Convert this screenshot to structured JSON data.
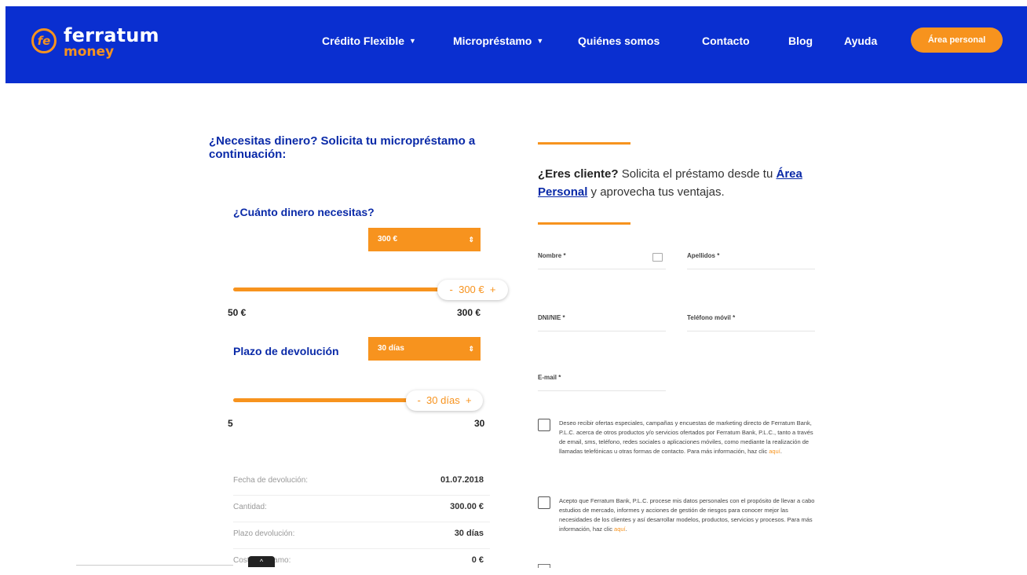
{
  "brand": {
    "name": "ferratum",
    "sub": "money",
    "mark": "fe",
    "accent": "#f7931e",
    "nav_bg": "#0a2fd0"
  },
  "nav": {
    "items": [
      {
        "label": "Crédito Flexible",
        "caret": "▼"
      },
      {
        "label": "Micropréstamo",
        "caret": "▼"
      },
      {
        "label": "Quiénes somos"
      },
      {
        "label": "Contacto"
      },
      {
        "label": "Blog"
      },
      {
        "label": "Ayuda"
      }
    ],
    "cta": "Área personal"
  },
  "loan_form": {
    "title": "¿Necesitas dinero? Solicita tu micropréstamo a continuación:",
    "amount": {
      "question": "¿Cuánto dinero necesitas?",
      "select_value": "300 €",
      "slider_value": "300 €",
      "slider_fraction": 1.0,
      "min": "50 €",
      "max": "300 €",
      "minus": "-",
      "plus": "+"
    },
    "term": {
      "question": "Plazo de devolución",
      "select_value": "30 días",
      "slider_value": "30 días",
      "slider_fraction": 1.0,
      "min": "5",
      "max": "30",
      "minus": "-",
      "plus": "+"
    },
    "summary": [
      {
        "key": "Fecha de devolución:",
        "value": "01.07.2018"
      },
      {
        "key": "Cantidad:",
        "value": "300.00 €"
      },
      {
        "key": "Plazo devolución:",
        "value": "30 días"
      },
      {
        "key": "Coste préstamo:",
        "value": "0 €"
      }
    ]
  },
  "client": {
    "bold": "¿Eres cliente?",
    "text1": " Solicita el préstamo desde tu ",
    "link": "Área Personal",
    "text2": " y aprovecha tus ventajas."
  },
  "fields": {
    "nombre": "Nombre *",
    "apellidos": "Apellidos *",
    "dni": "DNI/NIE *",
    "telefono": "Teléfono móvil *",
    "email": "E-mail *"
  },
  "consents": [
    {
      "text": "Deseo recibir ofertas especiales, campañas y encuestas de marketing directo de Ferratum Bank, P.L.C. acerca de otros productos y/o servicios ofertados por Ferratum Bank, P.L.C., tanto a través de email, sms, teléfono, redes sociales o aplicaciones móviles, como mediante la realización de llamadas telefónicas u otras formas de contacto. Para más información, haz clic ",
      "link": "aquí",
      "end": "."
    },
    {
      "text": "Acepto que Ferratum Bank, P.L.C. procese mis datos personales con el propósito de llevar a cabo estudios de mercado, informes y acciones de gestión de riesgos para conocer mejor las necesidades de los clientes y así desarrollar modelos, productos, servicios y procesos. Para más información, haz clic ",
      "link": "aquí",
      "end": "."
    }
  ],
  "scroll_tab": "^"
}
